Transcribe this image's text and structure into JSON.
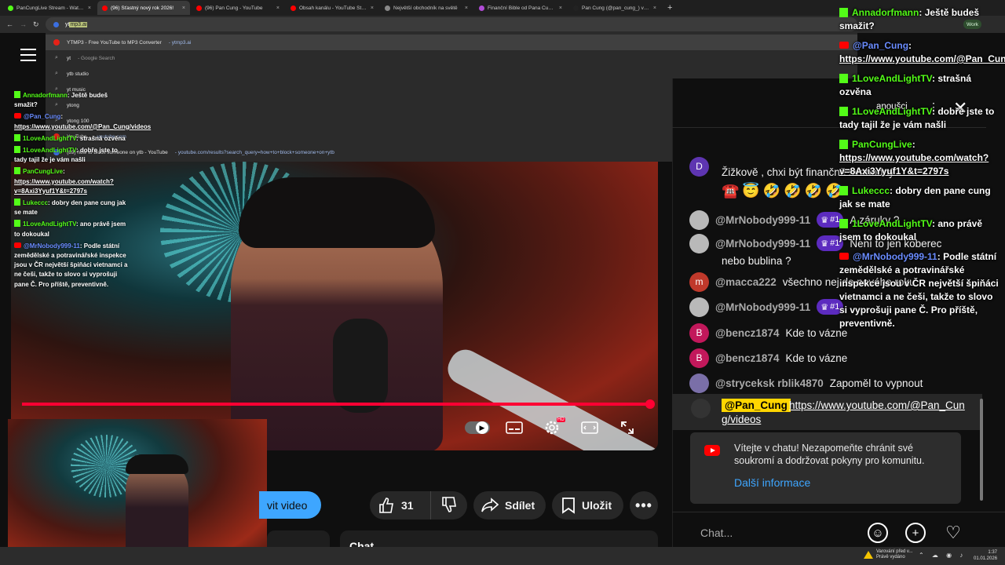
{
  "tabs": [
    {
      "title": "PanCungLive Stream - Watch Li...",
      "color": "#53fc18",
      "active": false
    },
    {
      "title": "(96) Šťastný nový rok 2026!",
      "color": "#ff0000",
      "active": true
    },
    {
      "title": "(96) Pan Čung - YouTube",
      "color": "#ff0000",
      "active": false
    },
    {
      "title": "Obsah kanálu - YouTube Studio",
      "color": "#ff0000",
      "active": false
    },
    {
      "title": "Největší obchodník na světě",
      "color": "#888888",
      "active": false
    },
    {
      "title": "Finanční Bible od Pana Čunga",
      "color": "#b04bd6",
      "active": false
    },
    {
      "title": "Pan Čung (@pan_cung_) využ...",
      "color": "#222222",
      "active": false
    }
  ],
  "omnibox": {
    "typed": "yt",
    "completion": "mp3.ai"
  },
  "work_badge": "Work",
  "suggestions": [
    {
      "icon": "yt",
      "main": "YTMP3 - Free YouTube to MP3 Converter",
      "sub": " - ytmp3.ai"
    },
    {
      "icon": "search",
      "main": "yt",
      "sub": " - Google Search"
    },
    {
      "icon": "search",
      "main": "ytb studio",
      "sub": ""
    },
    {
      "icon": "search",
      "main": "yt music",
      "sub": ""
    },
    {
      "icon": "search",
      "main": "ytong",
      "sub": ""
    },
    {
      "icon": "search",
      "main": "ytong 100",
      "sub": ""
    },
    {
      "icon": "yt",
      "main": "YouTube",
      "sub": " - youtube.com"
    },
    {
      "icon": "bl",
      "main": "(89) how to block someone on ytb - YouTube",
      "sub": " - youtube.com/results?search_query=how+to+block+someone+on+ytb"
    }
  ],
  "overlay_chat_small": [
    {
      "src": "kick",
      "name": "Annadorfmann",
      "text": "Ještě budeš smažit?"
    },
    {
      "src": "yt",
      "name": "@Pan_Cung",
      "text": "https://www.youtube.com/@Pan_Cung/videos",
      "link": true
    },
    {
      "src": "kick",
      "name": "1LoveAndLightTV",
      "text": "strašná ozvěna"
    },
    {
      "src": "kick",
      "name": "1LoveAndLightTV",
      "text": "dobře jste to tady tajil že je vám našli"
    },
    {
      "src": "kick",
      "name": "PanCungLive",
      "text": "https://www.youtube.com/watch?v=8Axi3Yyuf1Y&t=2797s",
      "link": true
    },
    {
      "src": "kick",
      "name": "Lukeccc",
      "text": "dobry den pane cung jak se mate"
    },
    {
      "src": "kick",
      "name": "1LoveAndLightTV",
      "text": "ano právě jsem to dokoukal"
    },
    {
      "src": "yt",
      "name": "@MrNobody999-11",
      "text": "Podle státní zemědělské a potravinářské inspekce jsou v ČR největší špiňáci vietnamci a ne češi, takže to slovo si vyprošuji pane Č. Pro příště, preventivně."
    }
  ],
  "overlay_chat_big": [
    {
      "src": "kick",
      "name": "Annadorfmann",
      "text": "Ještě budeš smažit?"
    },
    {
      "src": "yt",
      "name": "@Pan_Cung",
      "text": "https://www.youtube.com/@Pan_Cung/videos",
      "link": true
    },
    {
      "src": "kick",
      "name": "1LoveAndLightTV",
      "text": "strašná ozvěna"
    },
    {
      "src": "kick",
      "name": "1LoveAndLightTV",
      "text": "dobře jste to tady tajil že je vám našli"
    },
    {
      "src": "kick",
      "name": "PanCungLive",
      "text": "https://www.youtube.com/watch?v=8Axi3Yyuf1Y&t=2797s",
      "link": true
    },
    {
      "src": "kick",
      "name": "Lukeccc",
      "text": "dobry den pane cung jak se mate"
    },
    {
      "src": "kick",
      "name": "1LoveAndLightTV",
      "text": "ano právě jsem to dokoukal"
    },
    {
      "src": "yt",
      "name": "@MrNobody999-11",
      "text": "Podle státní zemědělské a potravinářské inspekce jsou v ČR největší špiňáci vietnamci a ne češi, takže to slovo si vyprošuji pane Č. Pro příště, preventivně."
    }
  ],
  "video": {
    "controls": {
      "autoplay": "▶",
      "subtitles": "CC",
      "hd": "HD"
    }
  },
  "actions": {
    "subscribe_partial": "vit video",
    "likes": "31",
    "share": "Sdílet",
    "save": "Uložit",
    "desc_partial": "Chat"
  },
  "chat": {
    "header_label": "anoušci",
    "prev_partial": "Žižkově , chxi být finančně svobodný",
    "rows": [
      {
        "avatar_letter": "",
        "avatar_color": "#b9b9b9",
        "name": "@MrNobody999-11",
        "badge": "#1",
        "text": "A záruky ?"
      },
      {
        "avatar_letter": "",
        "avatar_color": "#b9b9b9",
        "name": "@MrNobody999-11",
        "badge": "#1",
        "text": "Není to jen koberec"
      },
      {
        "avatar_letter": "",
        "avatar_color": "",
        "name": "",
        "badge": "",
        "text": "nebo bublina ?"
      },
      {
        "avatar_letter": "m",
        "avatar_color": "#c0392b",
        "name": "@macca222",
        "badge": "",
        "text": "všechno nej do nového roku"
      },
      {
        "avatar_letter": "",
        "avatar_color": "#b9b9b9",
        "name": "@MrNobody999-11",
        "badge": "#1",
        "text": ""
      },
      {
        "avatar_letter": "B",
        "avatar_color": "#c2185b",
        "name": "@bencz1874",
        "badge": "",
        "text": "Kde to vázne"
      },
      {
        "avatar_letter": "B",
        "avatar_color": "#c2185b",
        "name": "@bencz1874",
        "badge": "",
        "text": "Kde to vázne"
      },
      {
        "avatar_letter": "",
        "avatar_color": "#7a6fa8",
        "name": "@stryceksk rblik4870",
        "badge": "",
        "text": "Zapoměl to vypnout"
      }
    ],
    "pinned_name": "@Pan_Cung",
    "pinned_link": "https://www.youtube.com/@Pan_Cun",
    "pinned_link2": "g/videos",
    "welcome_text": "Vítejte v chatu! Nezapomeňte chránit své soukromí a dodržovat pokyny pro komunitu.",
    "welcome_more": "Další informace",
    "input_placeholder": "Chat..."
  },
  "taskbar": {
    "warning_line1": "Varování před v...",
    "warning_line2": "Právě vydáno",
    "time": "1:37",
    "date": "01.01.2026"
  },
  "colors": {
    "youtube_red": "#ff0000",
    "progress": "#ff0033",
    "subscribe_blue": "#3ea6ff",
    "kick_green": "#53fc18",
    "pinned_yellow": "#ffd600"
  }
}
